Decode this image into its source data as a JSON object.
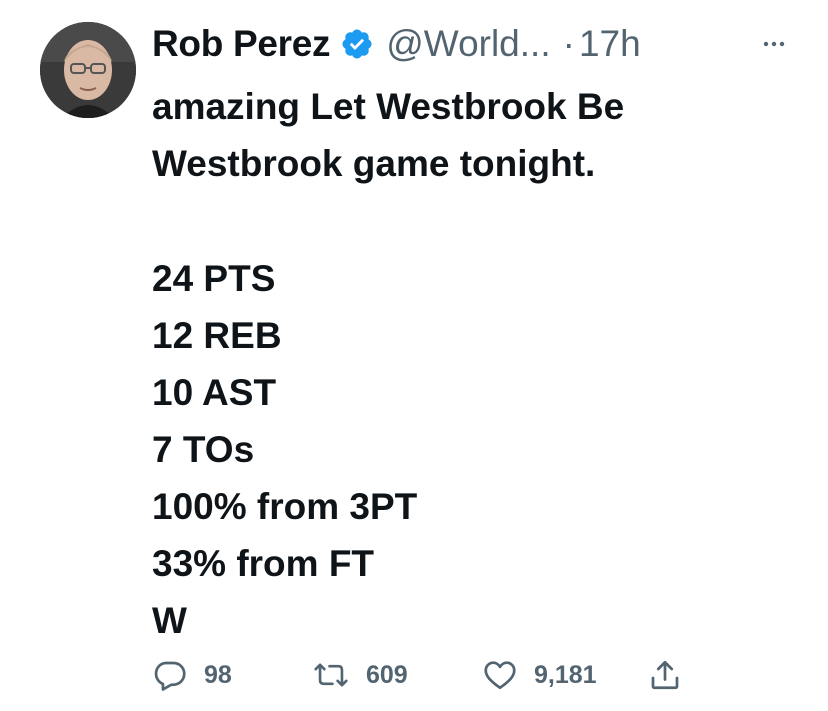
{
  "tweet": {
    "author": {
      "display_name": "Rob Perez",
      "handle": "@World...",
      "verified": true
    },
    "separator": "·",
    "time": "17h",
    "text_lines": [
      "amazing Let Westbrook Be",
      "Westbrook game tonight."
    ],
    "stat_lines": [
      "24 PTS",
      "12 REB",
      "10 AST",
      "7 TOs",
      "100% from 3PT",
      "33% from FT",
      "W"
    ]
  },
  "actions": {
    "reply_count": "98",
    "retweet_count": "609",
    "like_count": "9,181"
  },
  "colors": {
    "text": "#0f1419",
    "secondary": "#536471",
    "verified_badge": "#1d9bf0"
  },
  "icons": [
    "verified-badge-icon",
    "more-icon",
    "reply-icon",
    "retweet-icon",
    "like-icon",
    "share-icon"
  ]
}
